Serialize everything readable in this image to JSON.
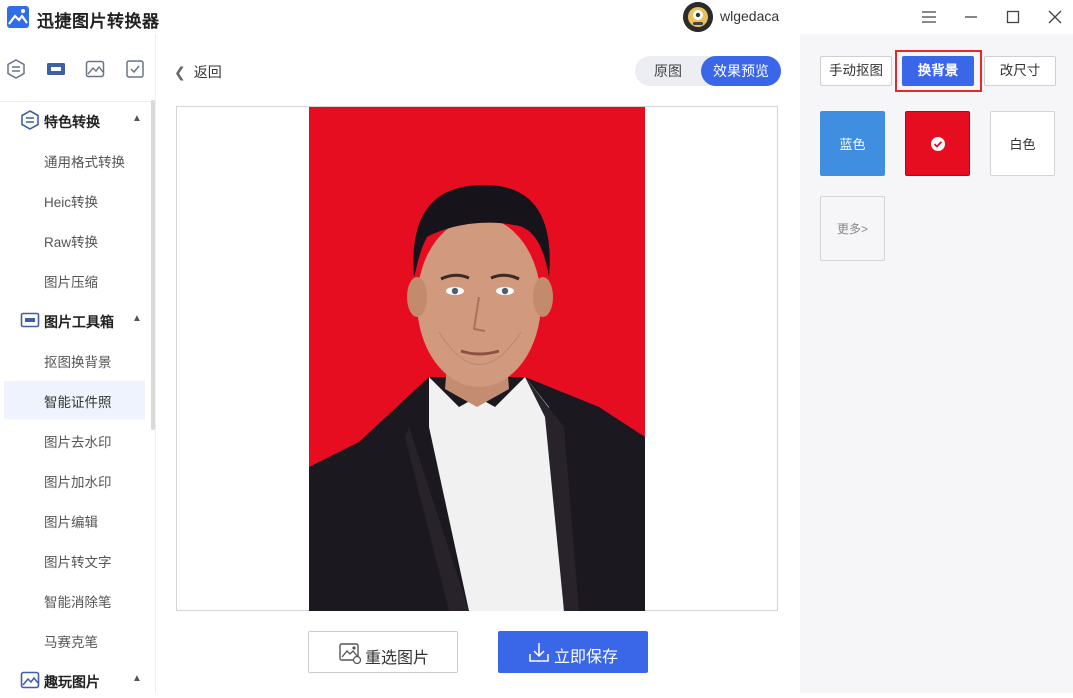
{
  "app": {
    "title": "迅捷图片转换器",
    "username": "wlgedaca"
  },
  "window_controls": [
    "menu-icon",
    "minimize-icon",
    "maximize-icon",
    "close-icon"
  ],
  "sidebar": {
    "top_icons": [
      "convert-icon",
      "toolbox-icon",
      "image-icon",
      "check-icon"
    ],
    "sections": [
      {
        "label": "特色转换",
        "icon": "convert-icon",
        "items": [
          "通用格式转换",
          "Heic转换",
          "Raw转换",
          "图片压缩"
        ]
      },
      {
        "label": "图片工具箱",
        "icon": "toolbox-icon",
        "items": [
          "抠图换背景",
          "智能证件照",
          "图片去水印",
          "图片加水印",
          "图片编辑",
          "图片转文字",
          "智能消除笔",
          "马赛克笔"
        ]
      },
      {
        "label": "趣玩图片",
        "icon": "image-icon",
        "items": []
      }
    ],
    "active_item": "智能证件照"
  },
  "main": {
    "back_label": "返回",
    "toggle": {
      "original": "原图",
      "preview": "效果预览",
      "selected": "效果预览"
    },
    "reselect_label": "重选图片",
    "save_label": "立即保存"
  },
  "right_panel": {
    "tabs": [
      "手动抠图",
      "换背景",
      "改尺寸"
    ],
    "active_tab": "换背景",
    "swatches": [
      {
        "label": "蓝色",
        "color": "#3f8ee0"
      },
      {
        "label": "",
        "color": "#e60d20",
        "selected": true
      },
      {
        "label": "白色",
        "color": "#ffffff"
      },
      {
        "label": "更多>",
        "color": "#f6f6f8"
      }
    ]
  },
  "colors": {
    "accent": "#3a66e8",
    "photo_background": "#e60d20",
    "highlight": "#e22a2a"
  }
}
